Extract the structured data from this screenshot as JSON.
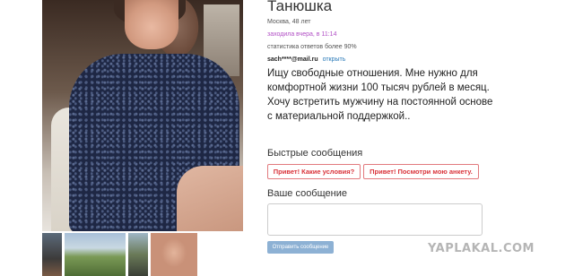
{
  "profile": {
    "name": "Танюшка",
    "city_age": "Москва, 48 лет",
    "last_visit": "заходила вчера, в 11:14",
    "stats": "статистика ответов более 90%",
    "email": "sach****@mail.ru",
    "email_open": "открыть",
    "about": "Ищу свободные отношения. Мне нужно для комфортной жизни 100 тысяч рублей в месяц. Хочу встретить мужчину на постоянной основе с материальной поддержкой.."
  },
  "quick": {
    "title": "Быстрые сообщения",
    "buttons": [
      "Привет! Какие условия?",
      "Привет! Посмотри мою анкету."
    ]
  },
  "message": {
    "title": "Ваше сообщение",
    "placeholder": "",
    "send_label": "Отправить сообщение"
  },
  "watermark": "YAPLAKAL.COM",
  "colors": {
    "last_visit": "#b14fc5",
    "quick_button_text": "#d9333a",
    "send_button_bg": "#8db1d4"
  }
}
